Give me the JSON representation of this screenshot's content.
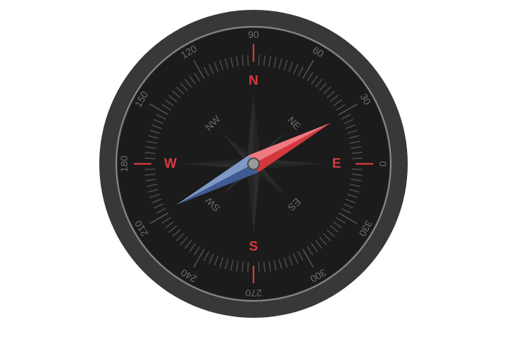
{
  "compass": {
    "cardinals": [
      {
        "label": "N",
        "angle": 90
      },
      {
        "label": "E",
        "angle": 0
      },
      {
        "label": "S",
        "angle": 270
      },
      {
        "label": "W",
        "angle": 180
      }
    ],
    "intercardinals": [
      {
        "label": "NE",
        "angle": 45
      },
      {
        "label": "NW",
        "angle": 135
      },
      {
        "label": "SW",
        "angle": 225
      },
      {
        "label": "ES",
        "angle": 315
      }
    ],
    "degree_labels": [
      "0",
      "30",
      "60",
      "90",
      "120",
      "150",
      "180",
      "210",
      "240",
      "270",
      "300",
      "330"
    ],
    "needle_heading_deg": 28,
    "colors": {
      "bezel": "#383838",
      "bezel_ring": "#8a8a8a",
      "face": "#1b1b1b",
      "tick": "#4a4a4a",
      "degree_text": "#6e6e6e",
      "intercardinal_text": "#6b6b6b",
      "accent": "#d93a3f",
      "needle_north_light": "#f07a82",
      "needle_north_dark": "#d4383e",
      "needle_south_light": "#7f98c6",
      "needle_south_dark": "#3e5b93",
      "rose": "#2e2e2e",
      "hub": "#9a9a9a"
    }
  }
}
